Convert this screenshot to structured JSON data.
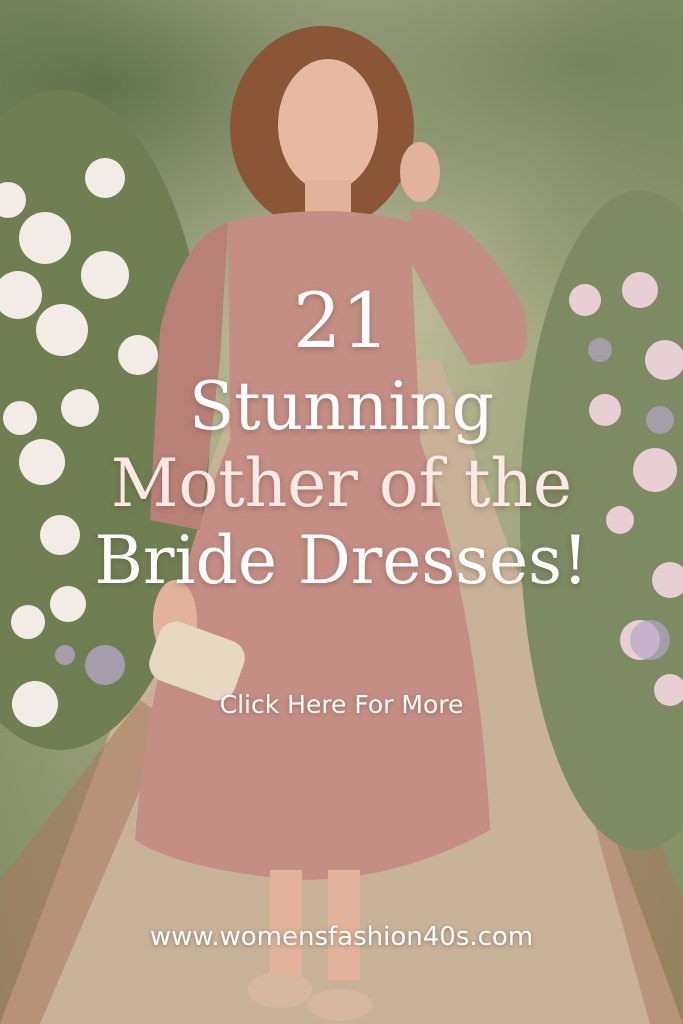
{
  "headline": {
    "number": "21",
    "line1": "Stunning",
    "line2": "Mother of the",
    "line3": "Bride Dresses!"
  },
  "cta_label": "Click Here For More",
  "website": "www.womensfashion40s.com",
  "colors": {
    "dress": "#c48e84",
    "path": "#c9b398",
    "foliage": "#7f8c62",
    "roses": "#f3ece6",
    "text": "#ffffff"
  }
}
